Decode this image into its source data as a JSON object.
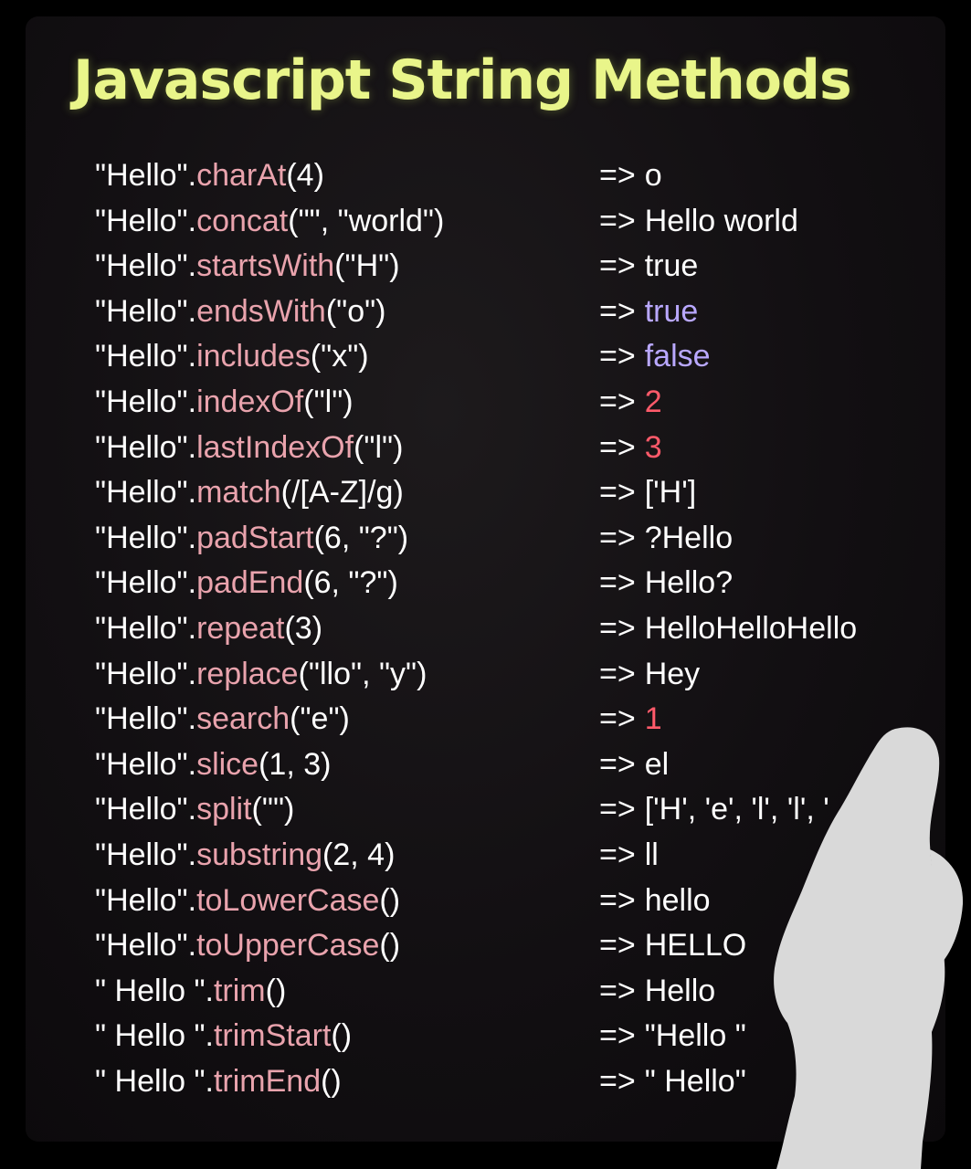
{
  "title": "Javascript String Methods",
  "colors": {
    "title": "#e9f58a",
    "method": "#f2a4b0",
    "text": "#ffffff",
    "result_blue": "#b9a8ff",
    "result_red": "#ff5a6a",
    "overlay": "#d9d9d9"
  },
  "rows": [
    {
      "prefix": "\"Hello\".",
      "method": "charAt",
      "args": "(4)",
      "arrow": "=>",
      "result": "o",
      "method_color": "#e9a3ad",
      "result_color": "#ffffff"
    },
    {
      "prefix": "\"Hello\".",
      "method": "concat",
      "args": "(\"\", \"world\")",
      "arrow": "=>",
      "result": "Hello world",
      "method_color": "#e9a3ad",
      "result_color": "#ffffff"
    },
    {
      "prefix": "\"Hello\".",
      "method": "startsWith",
      "args": "(\"H\")",
      "arrow": "=>",
      "result": "true",
      "method_color": "#e9a3ad",
      "result_color": "#ffffff"
    },
    {
      "prefix": "\"Hello\".",
      "method": "endsWith",
      "args": "(\"o\")",
      "arrow": "=>",
      "result": "true",
      "method_color": "#e9a3ad",
      "result_color": "#b9a8ff"
    },
    {
      "prefix": "\"Hello\".",
      "method": "includes",
      "args": "(\"x\")",
      "arrow": "=>",
      "result": "false",
      "method_color": "#e9a3ad",
      "result_color": "#b9a8ff"
    },
    {
      "prefix": "\"Hello\".",
      "method": "indexOf",
      "args": "(\"l\")",
      "arrow": "=>",
      "result": "2",
      "method_color": "#e9a3ad",
      "result_color": "#ff5a6a"
    },
    {
      "prefix": "\"Hello\".",
      "method": "lastIndexOf",
      "args": "(\"l\")",
      "arrow": "=>",
      "result": "3",
      "method_color": "#e9a3ad",
      "result_color": "#ff5a6a"
    },
    {
      "prefix": "\"Hello\".",
      "method": "match",
      "args": "(/[A-Z]/g)",
      "arrow": "=>",
      "result": "['H']",
      "method_color": "#e9a3ad",
      "result_color": "#ffffff"
    },
    {
      "prefix": "\"Hello\".",
      "method": "padStart",
      "args": "(6, \"?\")",
      "arrow": "=>",
      "result": "?Hello",
      "method_color": "#e9a3ad",
      "result_color": "#ffffff"
    },
    {
      "prefix": "\"Hello\".",
      "method": "padEnd",
      "args": "(6, \"?\")",
      "arrow": "=>",
      "result": "Hello?",
      "method_color": "#e9a3ad",
      "result_color": "#ffffff"
    },
    {
      "prefix": "\"Hello\".",
      "method": "repeat",
      "args": "(3)",
      "arrow": "=>",
      "result": "HelloHelloHello",
      "method_color": "#e9a3ad",
      "result_color": "#ffffff"
    },
    {
      "prefix": "\"Hello\".",
      "method": "replace",
      "args": "(\"llo\", \"y\")",
      "arrow": "=>",
      "result": "Hey",
      "method_color": "#e9a3ad",
      "result_color": "#ffffff"
    },
    {
      "prefix": "\"Hello\".",
      "method": "search",
      "args": "(\"e\")",
      "arrow": "=>",
      "result": "1",
      "method_color": "#e9a3ad",
      "result_color": "#ff5a6a"
    },
    {
      "prefix": "\"Hello\".",
      "method": "slice",
      "args": "(1, 3)",
      "arrow": "=>",
      "result": "el",
      "method_color": "#e9a3ad",
      "result_color": "#ffffff"
    },
    {
      "prefix": "\"Hello\".",
      "method": "split",
      "args": "(\"\")",
      "arrow": "=>",
      "result": "['H', 'e', 'l', 'l', '",
      "method_color": "#e9a3ad",
      "result_color": "#ffffff"
    },
    {
      "prefix": "\"Hello\".",
      "method": "substring",
      "args": "(2, 4)",
      "arrow": "=>",
      "result": "ll",
      "method_color": "#e9a3ad",
      "result_color": "#ffffff"
    },
    {
      "prefix": "\"Hello\".",
      "method": "toLowerCase",
      "args": "()",
      "arrow": "=>",
      "result": "hello",
      "method_color": "#e9a3ad",
      "result_color": "#ffffff"
    },
    {
      "prefix": "\"Hello\".",
      "method": "toUpperCase",
      "args": "()",
      "arrow": "=>",
      "result": "HELLO",
      "method_color": "#e9a3ad",
      "result_color": "#ffffff"
    },
    {
      "prefix": "\"  Hello  \".",
      "method": "trim",
      "args": "()",
      "arrow": "=>",
      "result": "Hello",
      "method_color": "#e9a3ad",
      "result_color": "#ffffff"
    },
    {
      "prefix": "\"  Hello  \".",
      "method": "trimStart",
      "args": "()",
      "arrow": "=>",
      "result": "\"Hello  \"",
      "method_color": "#e9a3ad",
      "result_color": "#ffffff"
    },
    {
      "prefix": "\"  Hello  \".",
      "method": "trimEnd",
      "args": "()",
      "arrow": "=>",
      "result": "\"  Hello\"",
      "method_color": "#e9a3ad",
      "result_color": "#ffffff"
    }
  ]
}
